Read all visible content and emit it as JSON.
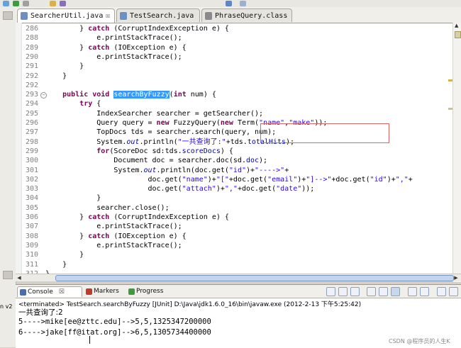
{
  "tabs": [
    {
      "label": "SearcherUtil.java",
      "close": "☒",
      "active": true
    },
    {
      "label": "TestSearch.java",
      "active": false
    },
    {
      "label": "PhraseQuery.class",
      "active": false
    }
  ],
  "code_lines": [
    {
      "n": "286",
      "html": "        } <span class=\"kw\">catch</span> (CorruptIndexException e) {"
    },
    {
      "n": "288",
      "html": "            e.printStackTrace();"
    },
    {
      "n": "289",
      "html": "        } <span class=\"kw\">catch</span> (IOException e) {"
    },
    {
      "n": "290",
      "html": "            e.printStackTrace();"
    },
    {
      "n": "291",
      "html": "        }"
    },
    {
      "n": "292",
      "html": "    }"
    },
    {
      "n": "292",
      "html": ""
    },
    {
      "n": "293",
      "fold": true,
      "html": "    <span class=\"kw\">public</span> <span class=\"kw\">void</span> <span class=\"sel\">searchByFuzzy</span>(<span class=\"kw\">int</span> num) {"
    },
    {
      "n": "294",
      "html": "        <span class=\"kw\">try</span> {"
    },
    {
      "n": "295",
      "html": "            IndexSearcher searcher = getSearcher();"
    },
    {
      "n": "296",
      "html": "            Query query = <span class=\"kw\">new</span> FuzzyQuery(<span class=\"kw\">new</span> Term(<span class=\"str\">\"name\"</span>,<span class=\"str\">\"make\"</span>));"
    },
    {
      "n": "297",
      "html": "            TopDocs tds = searcher.search(query, num);"
    },
    {
      "n": "298",
      "html": "            System.<span class=\"it\">out</span>.println(<span class=\"str\">\"一共查询了:\"</span>+tds.<span class=\"fld\">totalHits</span>);"
    },
    {
      "n": "299",
      "html": "            <span class=\"kw\">for</span>(ScoreDoc sd:tds.<span class=\"fld\">scoreDocs</span>) {"
    },
    {
      "n": "300",
      "html": "                Document doc = searcher.doc(sd.<span class=\"fld\">doc</span>);"
    },
    {
      "n": "301",
      "html": "                System.<span class=\"it\">out</span>.println(doc.get(<span class=\"str\">\"id\"</span>)+<span class=\"str\">\"---->\"</span>+"
    },
    {
      "n": "302",
      "html": "                        doc.get(<span class=\"str\">\"name\"</span>)+<span class=\"str\">\"[\"</span>+doc.get(<span class=\"str\">\"email\"</span>)+<span class=\"str\">\"]-->\"</span>+doc.get(<span class=\"str\">\"id\"</span>)+<span class=\"str\">\",\"</span>+"
    },
    {
      "n": "303",
      "html": "                        doc.get(<span class=\"str\">\"attach\"</span>)+<span class=\"str\">\",\"</span>+doc.get(<span class=\"str\">\"date\"</span>));"
    },
    {
      "n": "304",
      "html": "            }"
    },
    {
      "n": "305",
      "html": "            searcher.close();"
    },
    {
      "n": "306",
      "html": "        } <span class=\"kw\">catch</span> (CorruptIndexException e) {"
    },
    {
      "n": "307",
      "html": "            e.printStackTrace();"
    },
    {
      "n": "308",
      "html": "        } <span class=\"kw\">catch</span> (IOException e) {"
    },
    {
      "n": "309",
      "html": "            e.printStackTrace();"
    },
    {
      "n": "310",
      "html": "        }"
    },
    {
      "n": "311",
      "html": "    }"
    },
    {
      "n": "312",
      "html": "}"
    }
  ],
  "console": {
    "tabs": [
      {
        "label": "Console",
        "close": "☒",
        "active": true
      },
      {
        "label": "Markers",
        "active": false
      },
      {
        "label": "Progress",
        "active": false
      }
    ],
    "status": "<terminated> TestSearch.searchByFuzzy [JUnit] D:\\Java\\jdk1.6.0_16\\bin\\javaw.exe (2012-2-13 下午5:25:42)",
    "output": [
      "一共查询了:2",
      "5---->mike[ee@zttc.edu]-->5,5,1325347200000",
      "6---->jake[ff@itat.org]-->6,5,1305734400000"
    ]
  },
  "side_label": "n v2",
  "watermark": "CSDN @程序员的人生K",
  "colors": {
    "keyword": "#7f0055",
    "string": "#2a00ff",
    "field": "#0000c0",
    "selection": "#3399ff",
    "annotation": "#e06464"
  }
}
